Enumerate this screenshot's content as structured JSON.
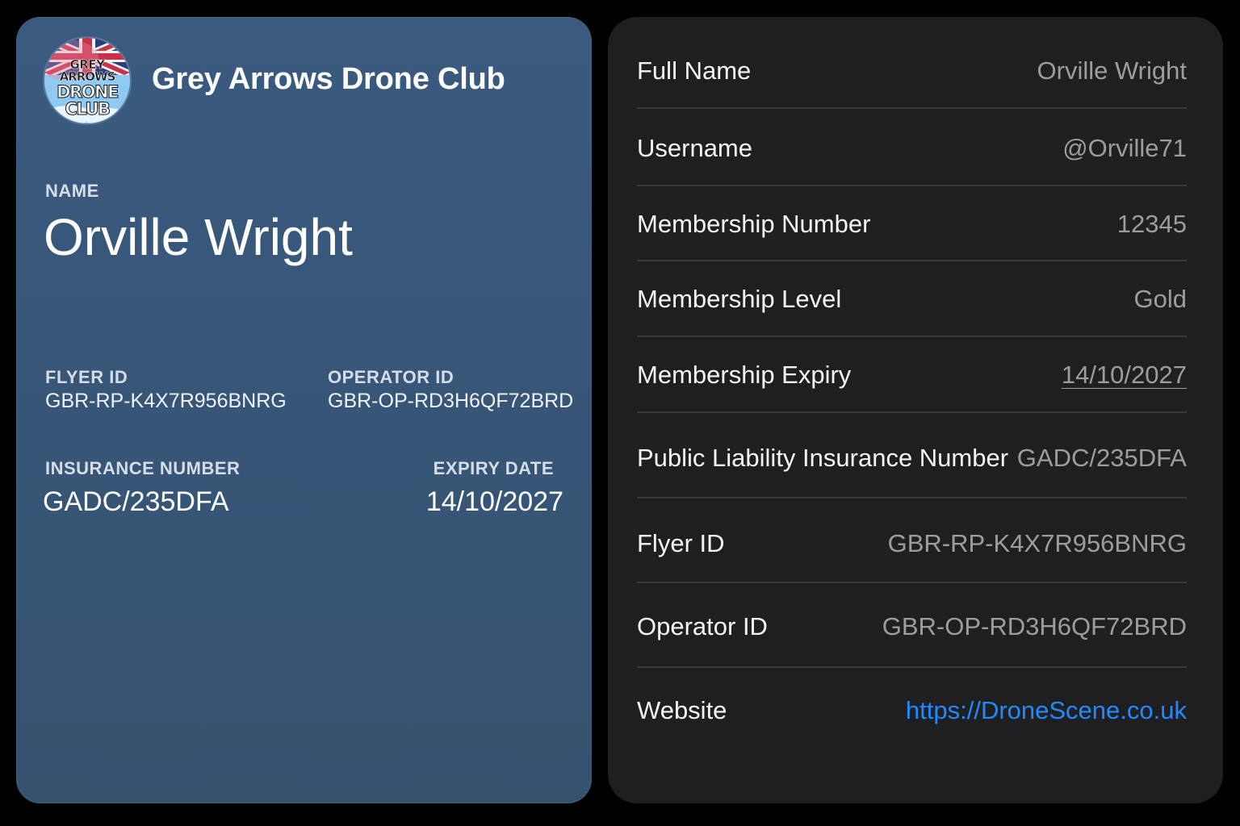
{
  "pass": {
    "club_name": "Grey Arrows Drone Club",
    "logo_text": [
      "GREY",
      "ARROWS",
      "DRONE",
      "CLUB"
    ],
    "name_label": "NAME",
    "name_value": "Orville Wright",
    "flyer_id_label": "FLYER ID",
    "flyer_id_value": "GBR-RP-K4X7R956BNRG",
    "operator_id_label": "OPERATOR ID",
    "operator_id_value": "GBR-OP-RD3H6QF72BRD",
    "insurance_label": "INSURANCE NUMBER",
    "insurance_value": "GADC/235DFA",
    "expiry_label": "EXPIRY DATE",
    "expiry_value": "14/10/2027",
    "colors": {
      "card_background": "#385779",
      "text": "#ffffff"
    }
  },
  "details": {
    "rows": [
      {
        "label": "Full Name",
        "value": "Orville Wright"
      },
      {
        "label": "Username",
        "value": "@Orville71"
      },
      {
        "label": "Membership Number",
        "value": "12345"
      },
      {
        "label": "Membership Level",
        "value": "Gold"
      },
      {
        "label": "Membership Expiry",
        "value": "14/10/2027"
      },
      {
        "label": "Public Liability Insurance Number",
        "value": "GADC/235DFA"
      },
      {
        "label": "Flyer ID",
        "value": "GBR-RP-K4X7R956BNRG"
      },
      {
        "label": "Operator ID",
        "value": "GBR-OP-RD3H6QF72BRD"
      },
      {
        "label": "Website",
        "value": "https://DroneScene.co.uk"
      }
    ],
    "colors": {
      "card_background": "#1f1f21",
      "value_text": "#9c9ca2",
      "link": "#1f8bff"
    }
  }
}
